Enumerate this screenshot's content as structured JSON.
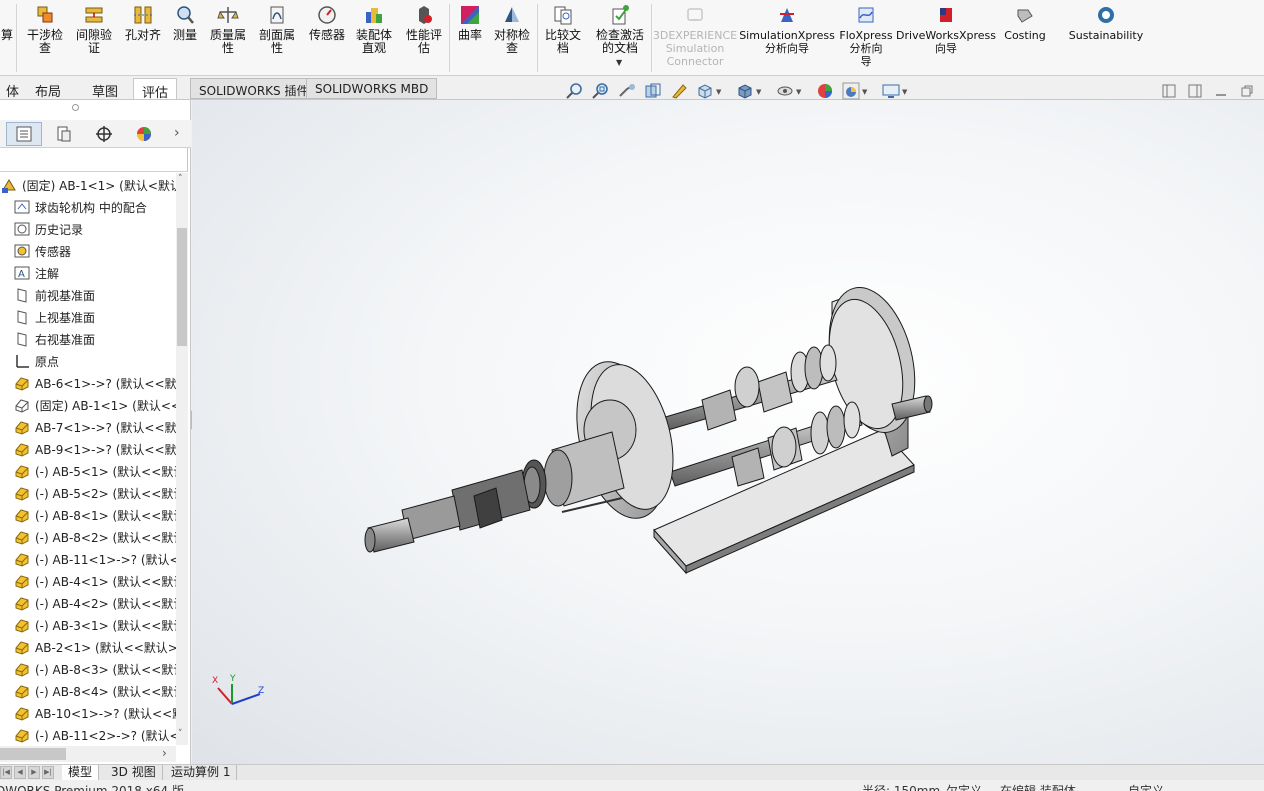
{
  "ribbon": {
    "cut_label": "算",
    "items": [
      {
        "name": "interference-check-button",
        "label": "干涉检\n查",
        "icon": "interference-icon"
      },
      {
        "name": "clearance-verification-button",
        "label": "间隙验\n证",
        "icon": "clearance-icon"
      },
      {
        "name": "hole-alignment-button",
        "label": "孔对齐",
        "icon": "hole-align-icon"
      },
      {
        "name": "measure-button",
        "label": "测量",
        "icon": "measure-icon"
      },
      {
        "name": "mass-properties-button",
        "label": "质量属\n性",
        "icon": "mass-icon"
      },
      {
        "name": "section-properties-button",
        "label": "剖面属\n性",
        "icon": "section-icon"
      },
      {
        "name": "sensor-button",
        "label": "传感器",
        "icon": "sensor-icon"
      },
      {
        "name": "assembly-visualization-button",
        "label": "装配体\n直观",
        "icon": "assembly-vis-icon"
      },
      {
        "name": "performance-evaluation-button",
        "label": "性能评\n估",
        "icon": "performance-icon"
      },
      {
        "name": "curvature-button",
        "label": "曲率",
        "icon": "curvature-icon"
      },
      {
        "name": "symmetry-check-button",
        "label": "对称检\n查",
        "icon": "symmetry-icon"
      },
      {
        "name": "compare-documents-button",
        "label": "比较文\n档",
        "icon": "compare-icon"
      },
      {
        "name": "check-active-document-button",
        "label": "检查激活\n的文档",
        "icon": "check-doc-icon"
      }
    ],
    "disabled_item": {
      "label": "3DEXPERIENCE\nSimulation\nConnector"
    },
    "addin_items": [
      {
        "name": "simulationxpress-button",
        "label": "SimulationXpress\n分析向导"
      },
      {
        "name": "floxpress-button",
        "label": "FloXpress\n分析向\n导"
      },
      {
        "name": "driveworksxpress-button",
        "label": "DriveWorksXpress\n向导"
      },
      {
        "name": "costing-button",
        "label": "Costing"
      },
      {
        "name": "sustainability-button",
        "label": "Sustainability"
      }
    ]
  },
  "command_tabs": {
    "tabs": [
      "体",
      "布局",
      "草图",
      "评估"
    ],
    "active": "评估",
    "addins": [
      "SOLIDWORKS 插件",
      "SOLIDWORKS MBD"
    ]
  },
  "tree": {
    "nodes": [
      {
        "text": "(固定) AB-1<1> (默认<默认_5",
        "icon": "assembly-icon"
      },
      {
        "text": "球齿轮机构 中的配合",
        "icon": "mates-folder-icon"
      },
      {
        "text": "历史记录",
        "icon": "history-icon"
      },
      {
        "text": "传感器",
        "icon": "sensor-icon"
      },
      {
        "text": "注解",
        "icon": "annotation-icon"
      },
      {
        "text": "前视基准面",
        "icon": "plane-icon"
      },
      {
        "text": "上视基准面",
        "icon": "plane-icon"
      },
      {
        "text": "右视基准面",
        "icon": "plane-icon"
      },
      {
        "text": "原点",
        "icon": "origin-icon"
      },
      {
        "text": "AB-6<1>->? (默认<<默认",
        "icon": "part-icon"
      },
      {
        "text": "(固定) AB-1<1> (默认<<",
        "icon": "part-fixed-icon"
      },
      {
        "text": "AB-7<1>->? (默认<<默认",
        "icon": "part-icon"
      },
      {
        "text": "AB-9<1>->? (默认<<默认",
        "icon": "part-icon"
      },
      {
        "text": "(-) AB-5<1> (默认<<默认",
        "icon": "part-icon"
      },
      {
        "text": "(-) AB-5<2> (默认<<默认",
        "icon": "part-icon"
      },
      {
        "text": "(-) AB-8<1> (默认<<默认",
        "icon": "part-icon"
      },
      {
        "text": "(-) AB-8<2> (默认<<默认",
        "icon": "part-icon"
      },
      {
        "text": "(-) AB-11<1>->? (默认<",
        "icon": "part-icon"
      },
      {
        "text": "(-) AB-4<1> (默认<<默认",
        "icon": "part-icon"
      },
      {
        "text": "(-) AB-4<2> (默认<<默认",
        "icon": "part-icon"
      },
      {
        "text": "(-) AB-3<1> (默认<<默认",
        "icon": "part-icon"
      },
      {
        "text": "AB-2<1> (默认<<默认>_",
        "icon": "part-icon"
      },
      {
        "text": "(-) AB-8<3> (默认<<默认",
        "icon": "part-icon"
      },
      {
        "text": "(-) AB-8<4> (默认<<默认",
        "icon": "part-icon"
      },
      {
        "text": "AB-10<1>->? (默认<<默",
        "icon": "part-icon"
      },
      {
        "text": "(-) AB-11<2>->? (默认<",
        "icon": "part-icon"
      }
    ]
  },
  "bottom_tabs": [
    "模型",
    "3D 视图",
    "运动算例 1"
  ],
  "status": {
    "app": "DWORKS Premium 2018 x64 版",
    "radius": "半径: 150mm",
    "defined": "欠定义",
    "editing": "在编辑 装配体",
    "custom": "自定义"
  },
  "triad": {
    "x": "X",
    "y": "Y",
    "z": "Z"
  },
  "colors": {
    "ribbon_bg": "#f7f7f7",
    "part_yellow": "#e8b93a",
    "model_gray": "#a9a9a9",
    "triad_x": "#d0202a",
    "triad_y": "#1a9a2a",
    "triad_z": "#1f3fc8"
  }
}
